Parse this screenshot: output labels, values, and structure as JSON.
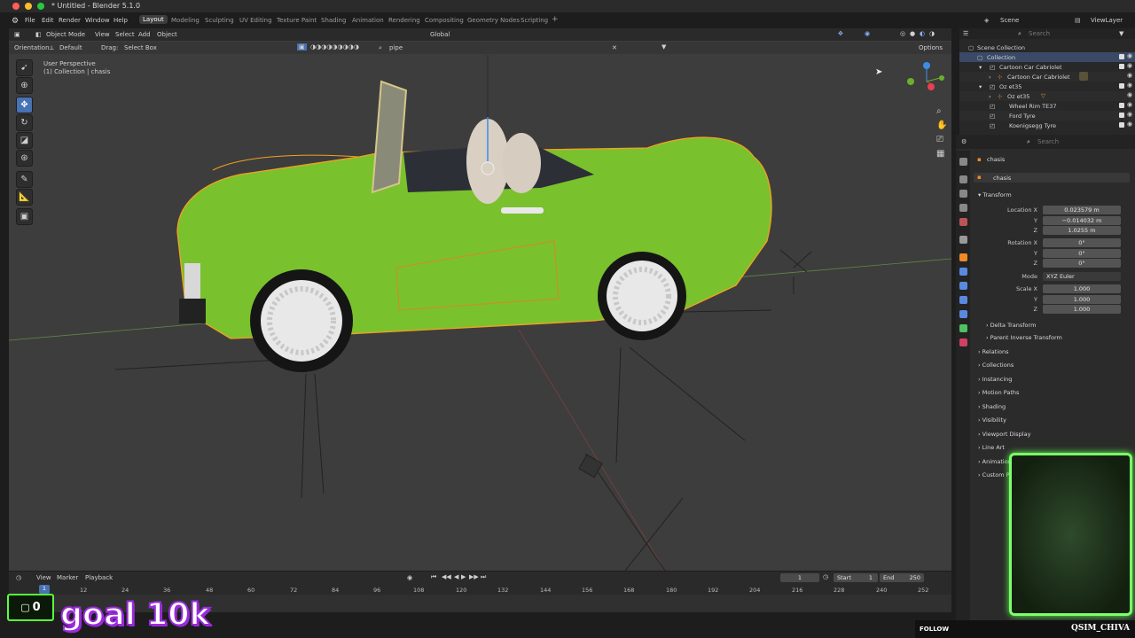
{
  "window": {
    "title": "* Untitled - Blender 5.1.0",
    "traffic_colors": [
      "#ff5f57",
      "#febc2e",
      "#28c840"
    ]
  },
  "menubar": {
    "menus": [
      "File",
      "Edit",
      "Render",
      "Window",
      "Help"
    ],
    "workspaces": [
      "Layout",
      "Modeling",
      "Sculpting",
      "UV Editing",
      "Texture Paint",
      "Shading",
      "Animation",
      "Rendering",
      "Compositing",
      "Geometry Nodes",
      "Scripting"
    ],
    "active_workspace": "Layout",
    "add_workspace": "+",
    "scene_label": "Scene",
    "viewlayer_label": "ViewLayer"
  },
  "viewport_header": {
    "mode": "Object Mode",
    "menus": [
      "View",
      "Select",
      "Add",
      "Object"
    ],
    "orientation_label": "Orientation:",
    "orientation_value": "Default",
    "drag_label": "Drag:",
    "drag_value": "Select Box",
    "search_value": "pipe",
    "transform_space": "Global",
    "options_label": "Options"
  },
  "viewport": {
    "view_name": "User Perspective",
    "collection_info": "(1) Collection | chasis",
    "car_color": "#7ac12e",
    "selection_outline": "#f4a020",
    "background": "#3d3d3d"
  },
  "outliner": {
    "search_placeholder": "Search",
    "rows": [
      {
        "label": "Scene Collection",
        "indent": 0
      },
      {
        "label": "Collection",
        "indent": 1,
        "selected": true
      },
      {
        "label": "Cartoon Car Cabriolet",
        "indent": 2
      },
      {
        "label": "Cartoon Car Cabriolet",
        "indent": 3
      },
      {
        "label": "Oz et35",
        "indent": 2
      },
      {
        "label": "Oz et35",
        "indent": 3
      },
      {
        "label": "Wheel Rim TE37",
        "indent": 2
      },
      {
        "label": "Ford Tyre",
        "indent": 2
      },
      {
        "label": "Koenigsegg Tyre",
        "indent": 2
      }
    ]
  },
  "properties": {
    "search_placeholder": "Search",
    "object_name": "chasis",
    "mesh_name": "chasis",
    "transform_label": "Transform",
    "location_label": "Location X",
    "location": [
      "0.023579 m",
      "−0.014032 m",
      "1.0255 m"
    ],
    "rotation_label": "Rotation X",
    "rotation": [
      "0°",
      "0°",
      "0°"
    ],
    "mode_label": "Mode",
    "mode_value": "XYZ Euler",
    "scale_label": "Scale X",
    "scale": [
      "1.000",
      "1.000",
      "1.000"
    ],
    "axis_y": "Y",
    "axis_z": "Z",
    "subpanels": [
      "Delta Transform",
      "Parent Inverse Transform"
    ],
    "panels": [
      "Relations",
      "Collections",
      "Instancing",
      "Motion Paths",
      "Shading",
      "Visibility",
      "Viewport Display",
      "Line Art",
      "Animation",
      "Custom Properties"
    ]
  },
  "timeline": {
    "menus": [
      "View",
      "Marker",
      "Playback"
    ],
    "current_frame": "1",
    "start_label": "Start",
    "start_value": "1",
    "end_label": "End",
    "end_value": "250",
    "ticks": [
      "1",
      "12",
      "24",
      "36",
      "48",
      "60",
      "72",
      "84",
      "96",
      "108",
      "120",
      "132",
      "144",
      "156",
      "168",
      "180",
      "192",
      "204",
      "216",
      "228",
      "240",
      "252"
    ]
  },
  "overlay": {
    "goal_counter": "0",
    "goal_text": "goal 10k",
    "follow_label": "FOLLOW",
    "channel_name": "QSIM_CHIVA",
    "webcam_border": "#7cff6a"
  }
}
